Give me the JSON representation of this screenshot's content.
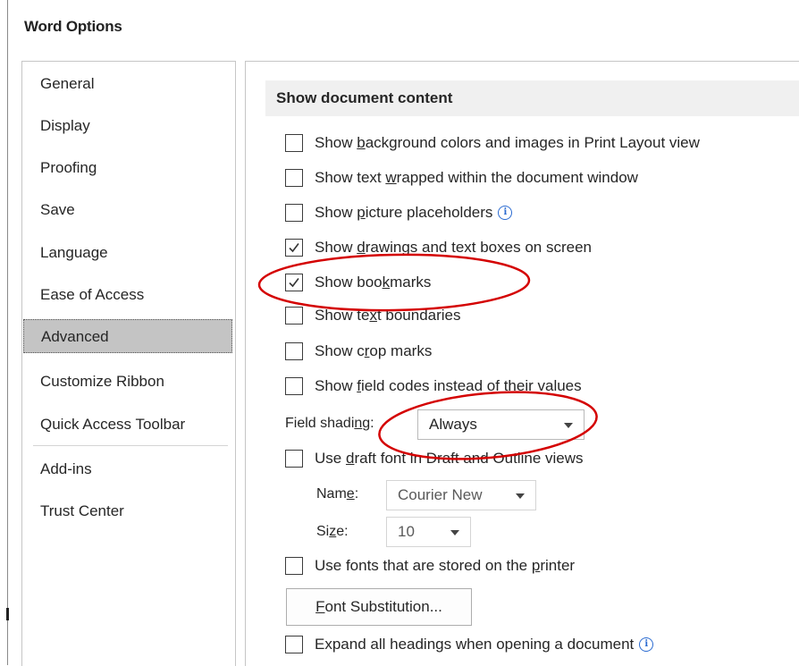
{
  "window": {
    "title": "Word Options"
  },
  "sidebar": {
    "items": [
      {
        "label": "General"
      },
      {
        "label": "Display"
      },
      {
        "label": "Proofing"
      },
      {
        "label": "Save"
      },
      {
        "label": "Language"
      },
      {
        "label": "Ease of Access"
      },
      {
        "label": "Advanced",
        "selected": true
      },
      {
        "label": "Customize Ribbon"
      },
      {
        "label": "Quick Access Toolbar"
      },
      {
        "label": "Add-ins"
      },
      {
        "label": "Trust Center"
      }
    ]
  },
  "section": {
    "title": "Show document content"
  },
  "options": {
    "bg_colors": {
      "pre": "Show ",
      "key": "b",
      "post": "ackground colors and images in Print Layout view",
      "checked": false
    },
    "text_wrapped": {
      "pre": "Show text ",
      "key": "w",
      "post": "rapped within the document window",
      "checked": false
    },
    "picture_placeholders": {
      "pre": "Show ",
      "key": "p",
      "post": "icture placeholders",
      "checked": false
    },
    "drawings": {
      "pre": "Show ",
      "key": "d",
      "post": "rawings and text boxes on screen",
      "checked": true
    },
    "bookmarks": {
      "pre": "Show boo",
      "key": "k",
      "post": "marks",
      "checked": true
    },
    "text_boundaries": {
      "pre": "Show te",
      "key": "x",
      "post": "t boundaries",
      "checked": false
    },
    "crop_marks": {
      "pre": "Show c",
      "key": "r",
      "post": "op marks",
      "checked": false
    },
    "field_codes": {
      "pre": "Show ",
      "key": "f",
      "post": "ield codes instead of their values",
      "checked": false
    },
    "draft_font": {
      "pre": "Use ",
      "key": "d",
      "post": "raft font in Draft and Outline views",
      "checked": false
    },
    "printer_fonts": {
      "pre": "Use fonts that are stored on the ",
      "key": "p",
      "post": "rinter",
      "checked": false
    },
    "expand_headings": {
      "label": "Expand all headings when opening a document",
      "checked": false
    }
  },
  "field_shading": {
    "pre": "Field shadi",
    "key": "n",
    "post": "g:",
    "value": "Always"
  },
  "draft_name": {
    "pre": "Nam",
    "key": "e",
    "post": ":",
    "value": "Courier New"
  },
  "draft_size": {
    "pre": "Si",
    "key": "z",
    "post": "e:",
    "value": "10"
  },
  "font_substitution": {
    "key": "F",
    "post": "ont Substitution..."
  },
  "colors": {
    "annotation": "#d40000",
    "selected_nav": "#c4c4c4",
    "section_bg": "#f0f0f0",
    "info_blue": "#2b6bd1"
  },
  "icons": {
    "info": "info-circle-icon",
    "checkmark": "checkmark-icon",
    "dropdown": "chevron-down-icon"
  }
}
